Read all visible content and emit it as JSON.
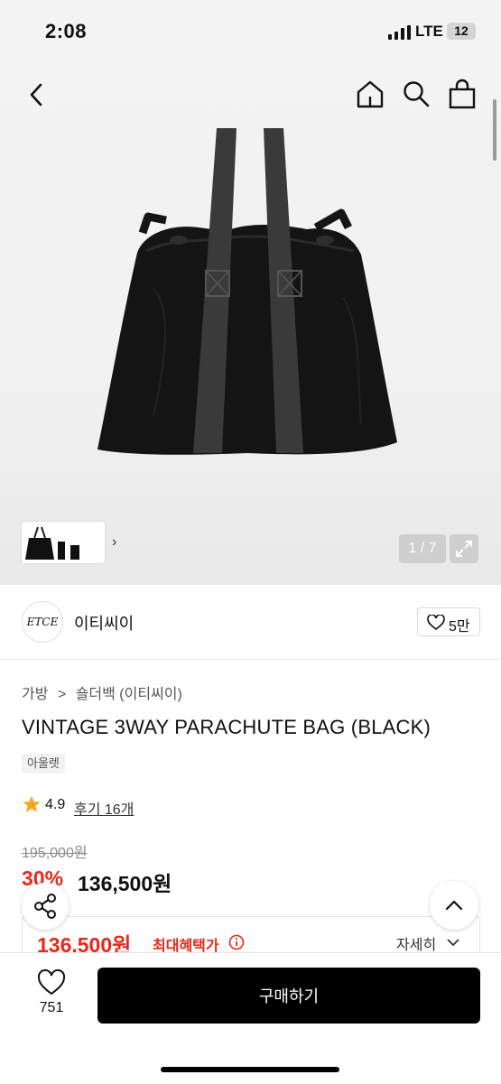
{
  "status_bar": {
    "time": "2:08",
    "network": "LTE",
    "battery": "12"
  },
  "gallery": {
    "counter": "1 / 7"
  },
  "brand": {
    "logo_text": "ETCE",
    "name": "이티씨이",
    "like_count": "5만"
  },
  "breadcrumb": [
    "가방",
    ">",
    "숄더백 (이티씨이)"
  ],
  "product": {
    "title": "VINTAGE 3WAY PARACHUTE BAG (BLACK)",
    "tag": "아울렛",
    "rating": "4.9",
    "reviews": "후기 16개",
    "original_price": "195,000원",
    "discount": "30%",
    "sale_price": "136,500원"
  },
  "benefit": {
    "price": "136,500원",
    "label": "최대혜택가",
    "detail": "자세히"
  },
  "bottom_bar": {
    "wishlist_count": "751",
    "buy_label": "구매하기"
  },
  "colors": {
    "accent_red": "#e8281b",
    "button_black": "#000000"
  }
}
